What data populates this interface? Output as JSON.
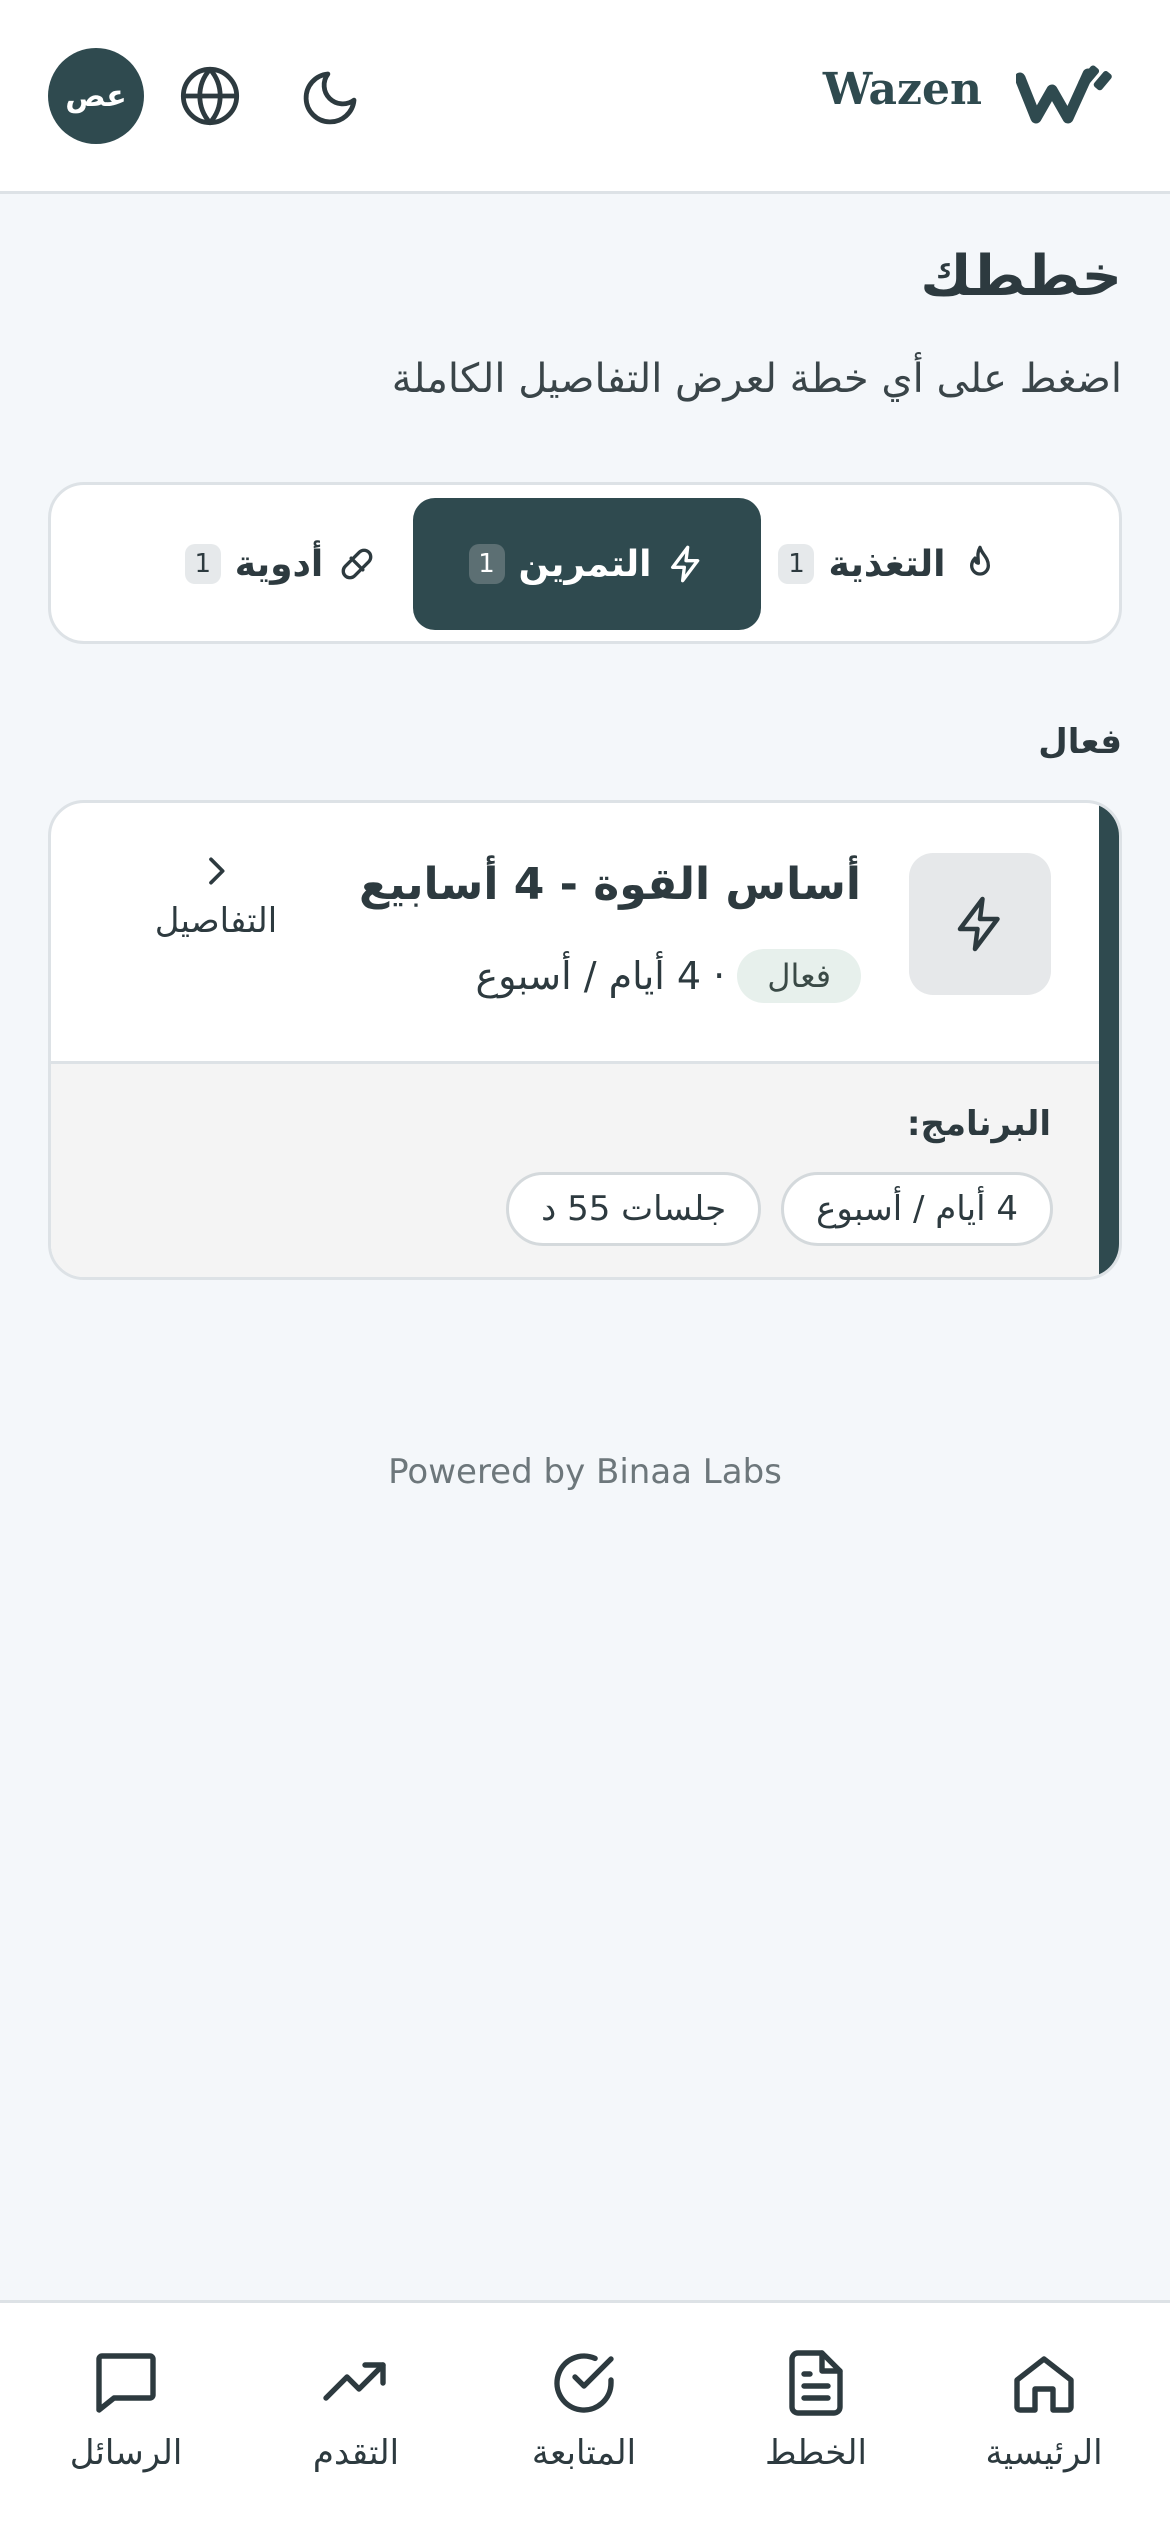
{
  "header": {
    "avatar_initials": "عص",
    "brand_name": "Wazen",
    "icons": [
      "globe-icon",
      "moon-icon",
      "wazen-logo"
    ]
  },
  "page": {
    "title": "خططك",
    "subtitle": "اضغط على أي خطة لعرض التفاصيل الكاملة"
  },
  "tabs": [
    {
      "label": "التغذية",
      "count": "1",
      "icon": "flame-icon",
      "active": false
    },
    {
      "label": "التمرين",
      "count": "1",
      "icon": "bolt-icon",
      "active": true
    },
    {
      "label": "أدوية",
      "count": "1",
      "icon": "pill-icon",
      "active": false
    }
  ],
  "section_label": "فعال",
  "plan": {
    "title": "أساس القوة - 4 أسابيع",
    "status": "فعال",
    "frequency": "· 4 أيام / أسبوع",
    "details_label": "التفاصيل",
    "program_label": "البرنامج:",
    "chips": [
      "4 أيام / أسبوع",
      "جلسات 55 د"
    ],
    "accent_color": "#2f4a4f"
  },
  "footer": {
    "powered_by": "Powered by Binaa Labs"
  },
  "bottom_nav": [
    {
      "label": "الرئيسية",
      "icon": "home-icon"
    },
    {
      "label": "الخطط",
      "icon": "document-icon"
    },
    {
      "label": "المتابعة",
      "icon": "check-circle-icon"
    },
    {
      "label": "التقدم",
      "icon": "trending-up-icon"
    },
    {
      "label": "الرسائل",
      "icon": "message-icon"
    }
  ]
}
